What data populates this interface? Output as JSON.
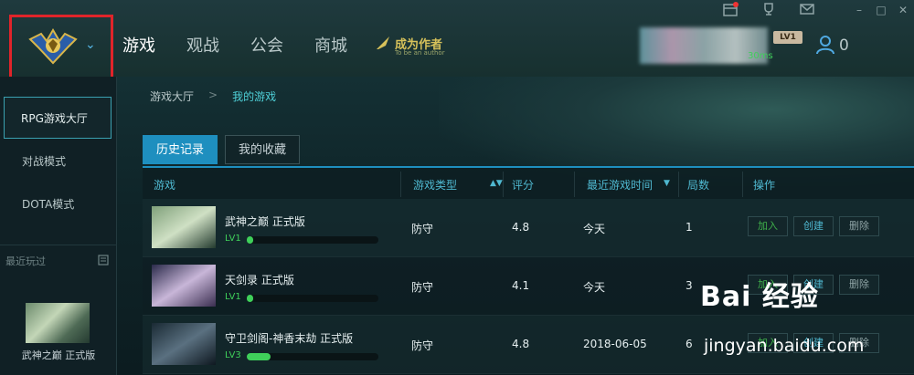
{
  "nav": {
    "items": [
      "游戏",
      "观战",
      "公会",
      "商城"
    ],
    "author_main": "成为作者",
    "author_sub": "To be an author"
  },
  "user": {
    "ping": "30ms",
    "level": "LV1",
    "count": "0"
  },
  "sidebar": {
    "items": [
      "RPG游戏大厅",
      "对战模式",
      "DOTA模式"
    ],
    "recent_label": "最近玩过",
    "recent_game": "武神之巅 正式版"
  },
  "breadcrumb": {
    "root": "游戏大厅",
    "sep": ">",
    "current": "我的游戏"
  },
  "tabs": [
    "历史记录",
    "我的收藏"
  ],
  "table": {
    "headers": {
      "game": "游戏",
      "type": "游戏类型",
      "rating": "评分",
      "last_played": "最近游戏时间",
      "rounds": "局数",
      "action": "操作"
    },
    "rows": [
      {
        "name": "武神之巅 正式版",
        "level": "LV1",
        "progress": 0.05,
        "type": "防守",
        "rating": "4.8",
        "last_played": "今天",
        "rounds": "1",
        "join": "加入",
        "create": "创建",
        "delete": "删除"
      },
      {
        "name": "天剑录 正式版",
        "level": "LV1",
        "progress": 0.05,
        "type": "防守",
        "rating": "4.1",
        "last_played": "今天",
        "rounds": "3",
        "join": "加入",
        "create": "创建",
        "delete": "删除"
      },
      {
        "name": "守卫剑阁-神香末劫 正式版",
        "level": "LV3",
        "progress": 0.18,
        "type": "防守",
        "rating": "4.8",
        "last_played": "2018-06-05",
        "rounds": "6",
        "join": "加入",
        "create": "创建",
        "delete": "删除"
      }
    ]
  },
  "watermark": {
    "logo": "Bai 经验",
    "url": "jingyan.baidu.com"
  },
  "colors": {
    "accent": "#1e8fbf",
    "highlight": "#4fd0d8",
    "progress": "#3fd05a",
    "logo_border": "#e0242a"
  }
}
